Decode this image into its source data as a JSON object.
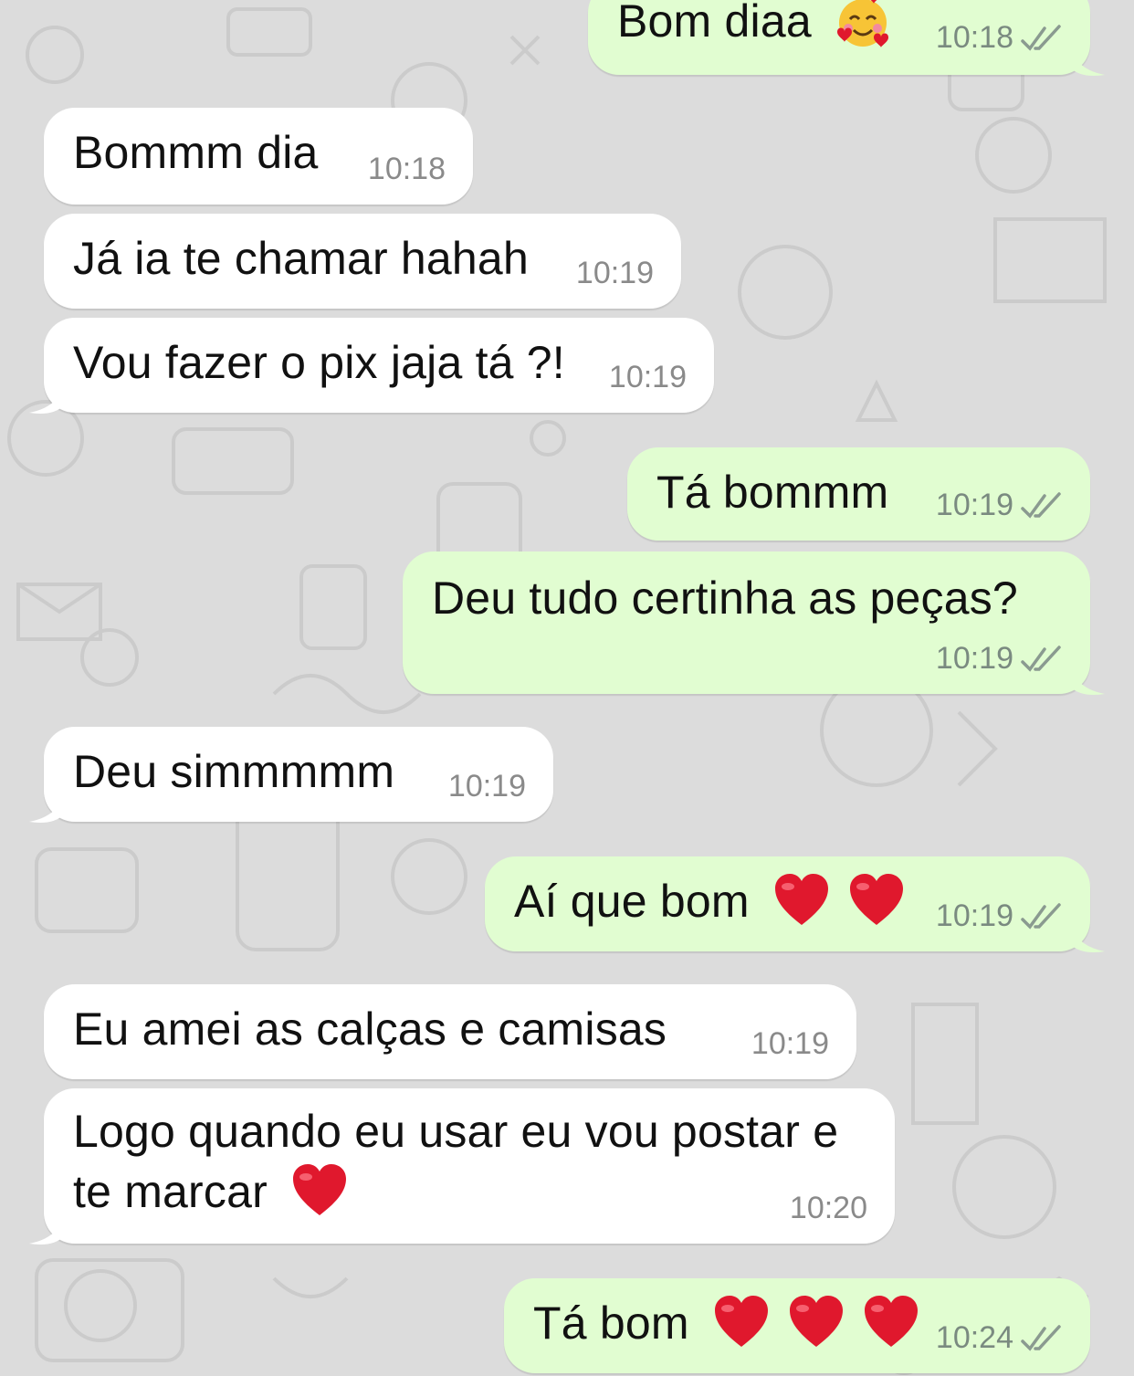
{
  "colors": {
    "background": "#dcdcdc",
    "incoming_bubble": "#ffffff",
    "outgoing_bubble": "#e1fdd1",
    "timestamp": "#7a8a80",
    "read_ticks": "#8a9a90",
    "heart": "#e0182d"
  },
  "messages": [
    {
      "direction": "out",
      "text": "Bom diaa",
      "emoji": "smiling-face-with-hearts",
      "time": "10:18",
      "status": "read"
    },
    {
      "direction": "in",
      "text": "Bommm dia",
      "time": "10:18"
    },
    {
      "direction": "in",
      "text": "Já ia te chamar hahah",
      "time": "10:19"
    },
    {
      "direction": "in",
      "text": "Vou fazer o pix jaja tá ?!",
      "time": "10:19"
    },
    {
      "direction": "out",
      "text": "Tá bommm",
      "time": "10:19",
      "status": "read"
    },
    {
      "direction": "out",
      "text": "Deu tudo certinha as peças?",
      "time": "10:19",
      "status": "read"
    },
    {
      "direction": "in",
      "text": "Deu simmmmm",
      "time": "10:19"
    },
    {
      "direction": "out",
      "text": "Aí que bom",
      "emoji": "red-heart x2",
      "time": "10:19",
      "status": "read"
    },
    {
      "direction": "in",
      "text": "Eu amei as calças e camisas",
      "time": "10:19"
    },
    {
      "direction": "in",
      "text_line1": "Logo quando eu usar eu vou postar e",
      "text_line2": "te marcar",
      "emoji": "red-heart",
      "time": "10:20"
    },
    {
      "direction": "out",
      "text": "Tá bom",
      "emoji": "red-heart x3",
      "time": "10:24",
      "status": "read"
    }
  ]
}
